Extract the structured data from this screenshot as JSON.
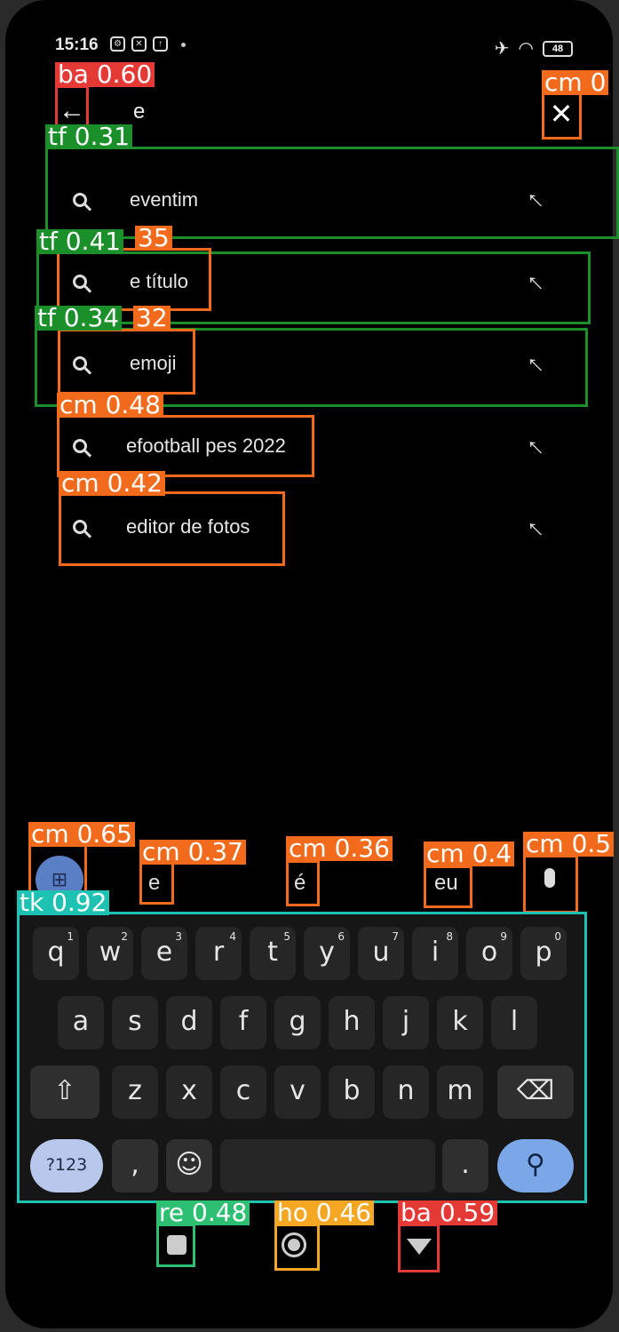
{
  "status_bar": {
    "time": "15:16",
    "battery": "48"
  },
  "search": {
    "query": "e"
  },
  "suggestions": [
    {
      "text": "eventim"
    },
    {
      "text": "e título"
    },
    {
      "text": "emoji"
    },
    {
      "text": "efootball pes 2022"
    },
    {
      "text": "editor de fotos"
    }
  ],
  "keyboard": {
    "suggestions": [
      "e",
      "é",
      "eu"
    ],
    "row1": [
      {
        "k": "q",
        "n": "1"
      },
      {
        "k": "w",
        "n": "2"
      },
      {
        "k": "e",
        "n": "3"
      },
      {
        "k": "r",
        "n": "4"
      },
      {
        "k": "t",
        "n": "5"
      },
      {
        "k": "y",
        "n": "6"
      },
      {
        "k": "u",
        "n": "7"
      },
      {
        "k": "i",
        "n": "8"
      },
      {
        "k": "o",
        "n": "9"
      },
      {
        "k": "p",
        "n": "0"
      }
    ],
    "row2": [
      "a",
      "s",
      "d",
      "f",
      "g",
      "h",
      "j",
      "k",
      "l"
    ],
    "row3": [
      "z",
      "x",
      "c",
      "v",
      "b",
      "n",
      "m"
    ],
    "numbers_key": "?123",
    "comma": ",",
    "period": "."
  },
  "detections": [
    {
      "label": "ba 0.60",
      "color": "#e53935"
    },
    {
      "label": "cm 0",
      "color": "#f26a1b"
    },
    {
      "label": "tf 0.31",
      "color": "#1a8f2a"
    },
    {
      "label": "tf 0.41",
      "color": "#1a8f2a"
    },
    {
      "label": "35",
      "color": "#f26a1b"
    },
    {
      "label": "tf 0.34",
      "color": "#1a8f2a"
    },
    {
      "label": "32",
      "color": "#f26a1b"
    },
    {
      "label": "cm 0.48",
      "color": "#f26a1b"
    },
    {
      "label": "cm 0.42",
      "color": "#f26a1b"
    },
    {
      "label": "cm 0.65",
      "color": "#f26a1b"
    },
    {
      "label": "cm 0.37",
      "color": "#f26a1b"
    },
    {
      "label": "cm 0.36",
      "color": "#f26a1b"
    },
    {
      "label": "cm 0.4",
      "color": "#f26a1b"
    },
    {
      "label": "cm 0.5",
      "color": "#f26a1b"
    },
    {
      "label": "tk 0.92",
      "color": "#1ec2b2"
    },
    {
      "label": "re 0.48",
      "color": "#2ec072"
    },
    {
      "label": "ho 0.46",
      "color": "#f5a623"
    },
    {
      "label": "ba 0.59",
      "color": "#e53935"
    }
  ]
}
